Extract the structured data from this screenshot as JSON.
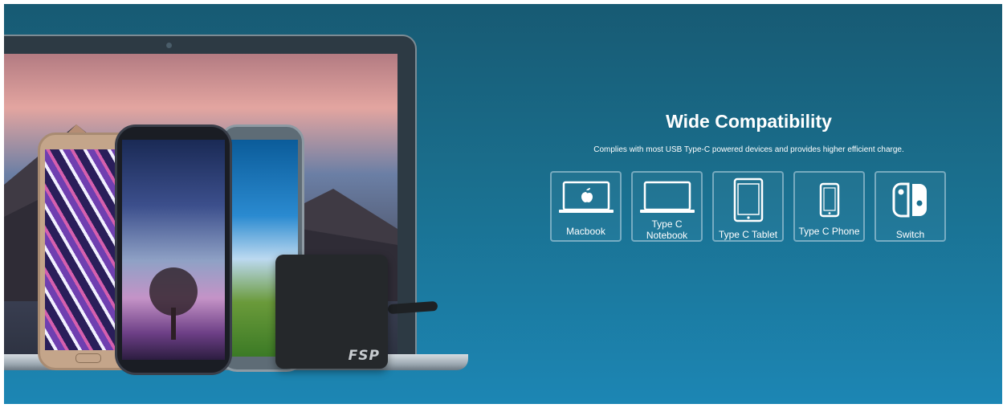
{
  "brand": {
    "logo_text": "FSP"
  },
  "section": {
    "title": "Wide Compatibility",
    "subtitle": "Complies with most USB Type-C powered devices and provides higher efficient charge."
  },
  "devices": [
    {
      "label": "Macbook",
      "icon": "laptop-apple-icon"
    },
    {
      "label_line1": "Type C",
      "label_line2": "Notebook",
      "icon": "laptop-icon"
    },
    {
      "label": "Type C Tablet",
      "icon": "tablet-icon"
    },
    {
      "label": "Type C Phone",
      "icon": "phone-icon"
    },
    {
      "label": "Switch",
      "icon": "switch-console-icon"
    }
  ],
  "colors": {
    "bg_top": "#175a73",
    "bg_bottom": "#1c86b4",
    "text": "#ffffff"
  }
}
